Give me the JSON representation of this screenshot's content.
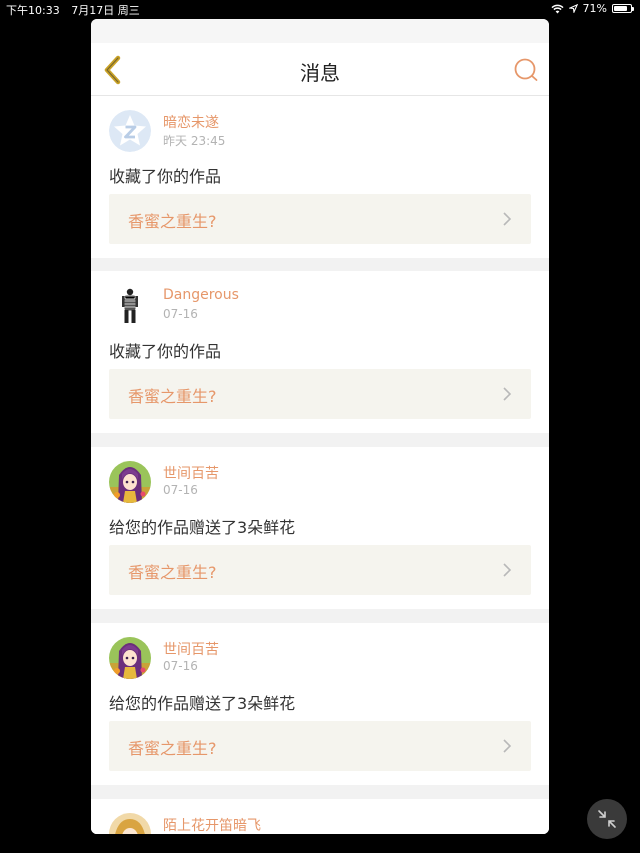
{
  "status_bar": {
    "time": "下午10:33",
    "date": "7月17日 周三",
    "battery": "71%",
    "battery_level": 0.71,
    "icons": [
      "wifi-icon",
      "location-arrow-icon",
      "battery-icon"
    ]
  },
  "nav": {
    "title": "消息",
    "back_icon": "chevron-left-icon",
    "search_icon": "search-icon"
  },
  "colors": {
    "accent": "#e6976a",
    "back_icon": "#c9a227",
    "card_link_bg": "#f5f4ee",
    "separator": "#f2f2f2"
  },
  "messages": [
    {
      "user": "暗恋未遂",
      "time": "昨天 23:45",
      "text": "收藏了你的作品",
      "work": "香蜜之重生?",
      "avatar": "default-qq-avatar"
    },
    {
      "user": "Dangerous",
      "time": "07-16",
      "text": "收藏了你的作品",
      "work": "香蜜之重生?",
      "avatar": "figure-avatar"
    },
    {
      "user": "世间百苦",
      "time": "07-16",
      "text": "给您的作品赠送了3朵鲜花",
      "work": "香蜜之重生?",
      "avatar": "anime-girl-avatar"
    },
    {
      "user": "世间百苦",
      "time": "07-16",
      "text": "给您的作品赠送了3朵鲜花",
      "work": "香蜜之重生?",
      "avatar": "anime-girl-avatar"
    }
  ],
  "partial_item": {
    "user": "陌上花开笛暗飞",
    "avatar": "blonde-avatar"
  },
  "floating_button_icon": "collapse-arrows-icon"
}
